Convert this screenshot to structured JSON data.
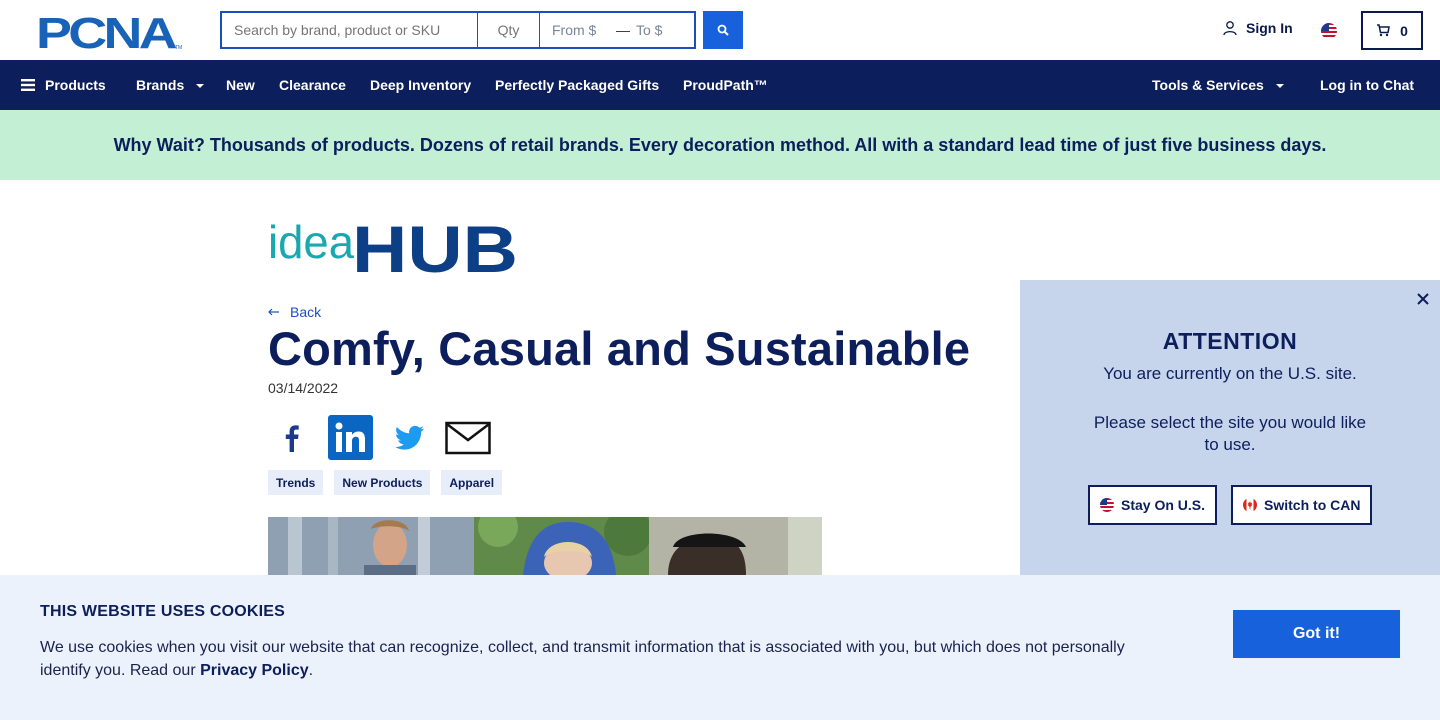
{
  "header": {
    "logo_text": "PCNA",
    "search_placeholder": "Search by brand, product or SKU",
    "qty_placeholder": "Qty",
    "price_from": "From $",
    "price_dash": "—",
    "price_to": "To $",
    "sign_in": "Sign In",
    "cart_count": "0"
  },
  "nav": {
    "products": "Products",
    "brands": "Brands",
    "new": "New",
    "clearance": "Clearance",
    "deep_inventory": "Deep Inventory",
    "gifts": "Perfectly Packaged Gifts",
    "proudpath": "ProudPath™",
    "tools": "Tools & Services",
    "chat": "Log in to Chat"
  },
  "promo": {
    "text": "Why Wait? Thousands of products. Dozens of retail brands. Every decoration method. All with a standard lead time of just five business days."
  },
  "article": {
    "hub_idea": "idea",
    "hub_word": "HUB",
    "back": "Back",
    "title": "Comfy, Casual and Sustainable",
    "date": "03/14/2022",
    "tags": [
      "Trends",
      "New Products",
      "Apparel"
    ]
  },
  "attention": {
    "title": "ATTENTION",
    "message": "You are currently on the U.S. site.",
    "select": "Please select the site you would like to use.",
    "stay": "Stay On U.S.",
    "switch": "Switch to CAN"
  },
  "cookie": {
    "title": "THIS WEBSITE USES COOKIES",
    "text": "We use cookies when you visit our website that can recognize, collect, and transmit information that is associated with you, but which does not personally identify you. Read our ",
    "link": "Privacy Policy",
    "end": ".",
    "button": "Got it!"
  },
  "colors": {
    "navy": "#0c1e5b",
    "accent_blue": "#1761dc",
    "promo_green": "#c3efd5",
    "attention_bg": "#c7d5ec",
    "cookie_bg": "#ecf2fb",
    "hub_teal": "#1aa8b0"
  }
}
